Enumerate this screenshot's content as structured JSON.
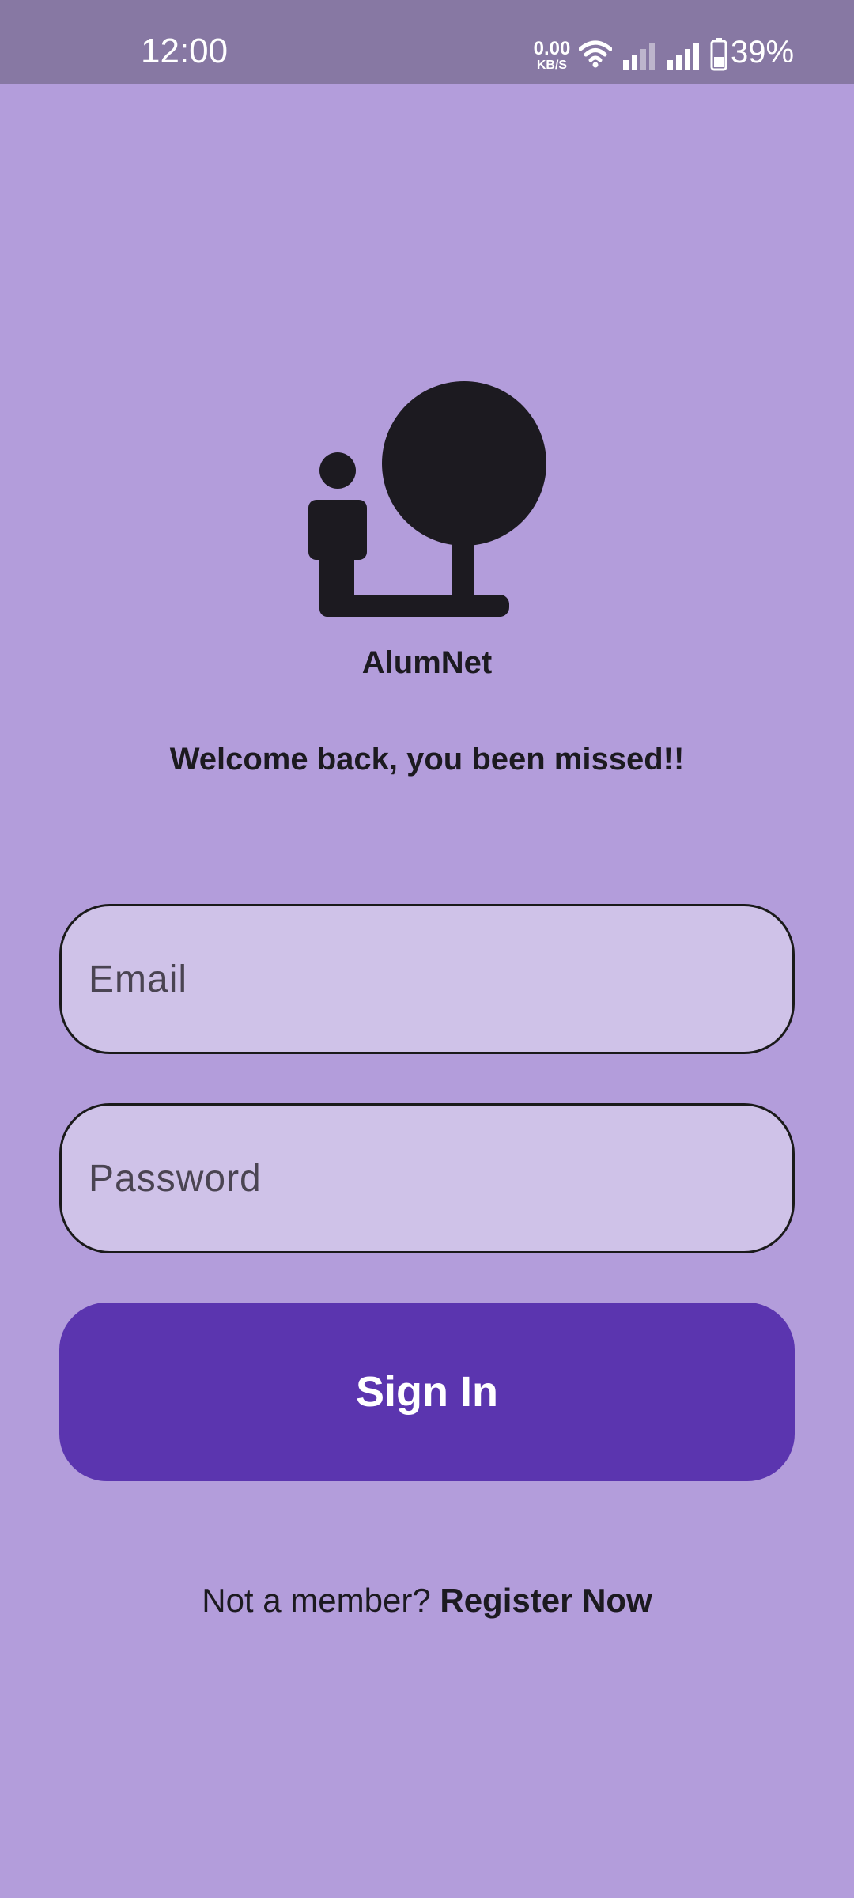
{
  "status_bar": {
    "time": "12:00",
    "net_speed_value": "0.00",
    "net_speed_unit": "KB/S",
    "battery_percent": "39%",
    "icons": [
      "wifi-icon",
      "signal-icon",
      "signal-icon",
      "battery-icon"
    ]
  },
  "app": {
    "name": "AlumNet",
    "welcome": "Welcome back, you been missed!!"
  },
  "form": {
    "email_placeholder": "Email",
    "password_placeholder": "Password",
    "sign_in_label": "Sign In"
  },
  "register": {
    "prompt": "Not a member?",
    "link_label": "Register Now"
  },
  "colors": {
    "background": "#b39ddb",
    "status_bar": "#8778a3",
    "input_fill": "#cfc2e8",
    "button": "#5b35af",
    "text": "#1c1a20"
  }
}
